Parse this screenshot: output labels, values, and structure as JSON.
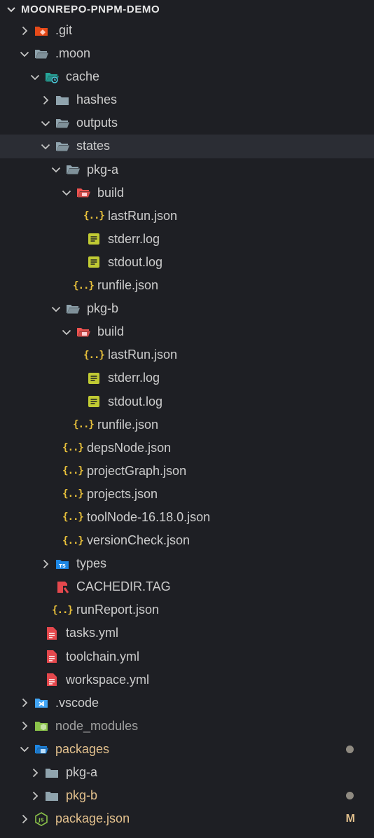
{
  "explorer": {
    "title": "MOONREPO-PNPM-DEMO",
    "colors": {
      "background": "#1e1f24",
      "text": "#cccccc",
      "modified": "#e2c08d",
      "json_icon": "#e9c13b",
      "folder": "#90a4ae",
      "yml_icon": "#e5484d",
      "log_icon": "#c0ca33"
    },
    "items": [
      {
        "label": ".git",
        "icon": "git-folder-icon",
        "chevron": "right"
      },
      {
        "label": ".moon",
        "icon": "folder-open-icon",
        "chevron": "down"
      },
      {
        "label": "cache",
        "icon": "cache-folder-icon",
        "chevron": "down"
      },
      {
        "label": "hashes",
        "icon": "folder-icon",
        "chevron": "right"
      },
      {
        "label": "outputs",
        "icon": "folder-open-icon",
        "chevron": "down"
      },
      {
        "label": "states",
        "icon": "folder-open-icon",
        "chevron": "down"
      },
      {
        "label": "pkg-a",
        "icon": "folder-open-icon",
        "chevron": "down"
      },
      {
        "label": "build",
        "icon": "build-folder-icon",
        "chevron": "down"
      },
      {
        "label": "lastRun.json",
        "icon": "json-icon"
      },
      {
        "label": "stderr.log",
        "icon": "log-icon"
      },
      {
        "label": "stdout.log",
        "icon": "log-icon"
      },
      {
        "label": "runfile.json",
        "icon": "json-icon"
      },
      {
        "label": "pkg-b",
        "icon": "folder-open-icon",
        "chevron": "down"
      },
      {
        "label": "build",
        "icon": "build-folder-icon",
        "chevron": "down"
      },
      {
        "label": "lastRun.json",
        "icon": "json-icon"
      },
      {
        "label": "stderr.log",
        "icon": "log-icon"
      },
      {
        "label": "stdout.log",
        "icon": "log-icon"
      },
      {
        "label": "runfile.json",
        "icon": "json-icon"
      },
      {
        "label": "depsNode.json",
        "icon": "json-icon"
      },
      {
        "label": "projectGraph.json",
        "icon": "json-icon"
      },
      {
        "label": "projects.json",
        "icon": "json-icon"
      },
      {
        "label": "toolNode-16.18.0.json",
        "icon": "json-icon"
      },
      {
        "label": "versionCheck.json",
        "icon": "json-icon"
      },
      {
        "label": "types",
        "icon": "ts-folder-icon",
        "chevron": "right"
      },
      {
        "label": "CACHEDIR.TAG",
        "icon": "tag-file-icon"
      },
      {
        "label": "runReport.json",
        "icon": "json-icon"
      },
      {
        "label": "tasks.yml",
        "icon": "yml-icon"
      },
      {
        "label": "toolchain.yml",
        "icon": "yml-icon"
      },
      {
        "label": "workspace.yml",
        "icon": "yml-icon"
      },
      {
        "label": ".vscode",
        "icon": "vscode-folder-icon",
        "chevron": "right"
      },
      {
        "label": "node_modules",
        "icon": "node-folder-icon",
        "chevron": "right",
        "gitignored": true
      },
      {
        "label": "packages",
        "icon": "packages-folder-icon",
        "chevron": "down",
        "modified": true,
        "badge": "dot"
      },
      {
        "label": "pkg-a",
        "icon": "folder-icon",
        "chevron": "right"
      },
      {
        "label": "pkg-b",
        "icon": "folder-icon",
        "chevron": "right",
        "modified": true,
        "badge": "dot"
      },
      {
        "label": "package.json",
        "icon": "nodejs-file-icon",
        "chevron": "right",
        "modified": true,
        "badge": "M"
      }
    ]
  }
}
